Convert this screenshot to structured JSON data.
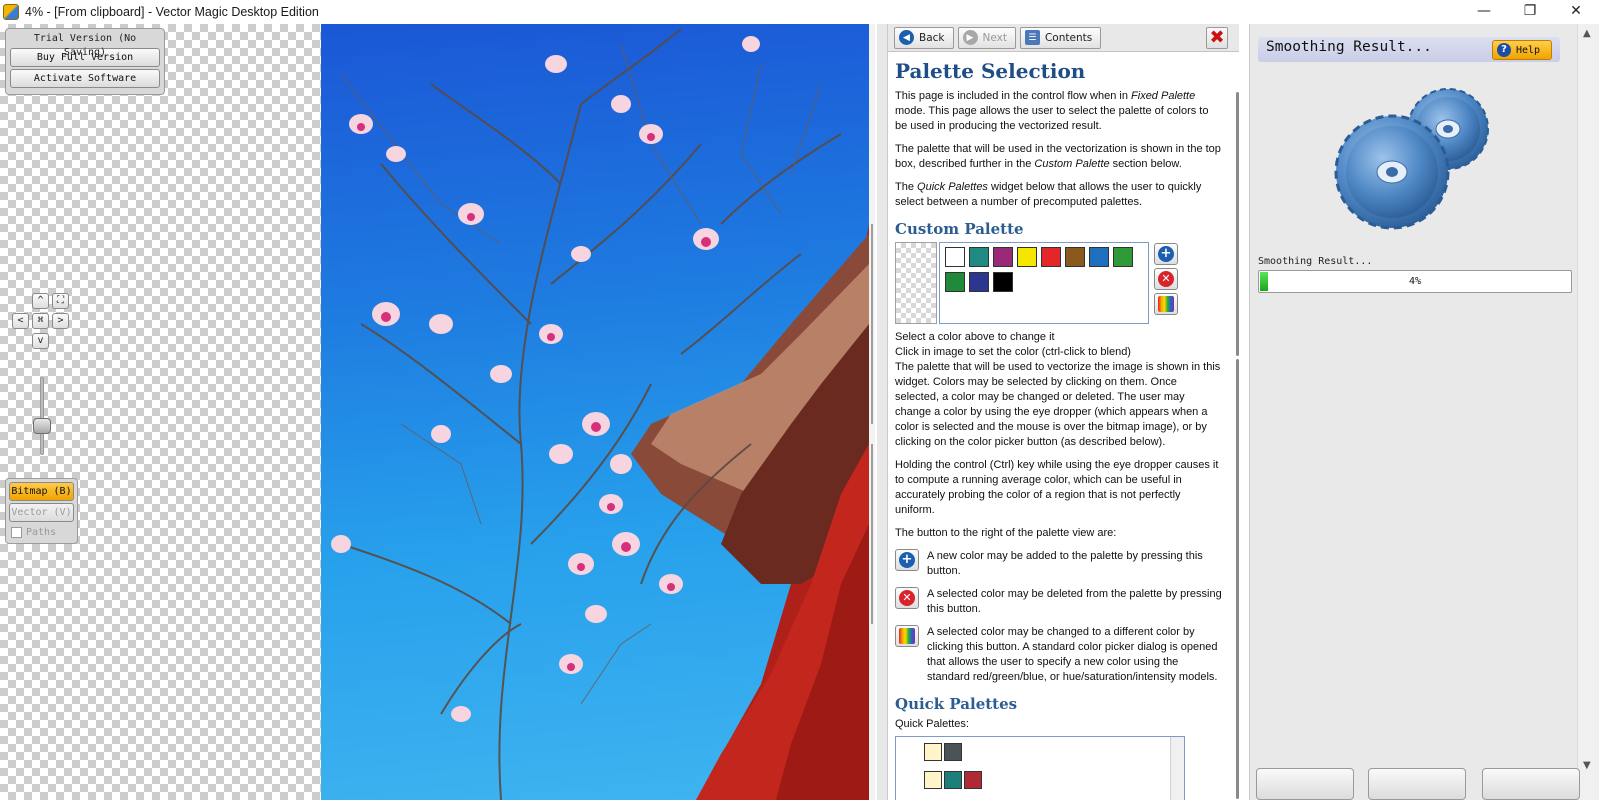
{
  "window": {
    "title": "4% - [From clipboard] - Vector Magic Desktop Edition",
    "controls": {
      "minimize": "—",
      "restore": "❐",
      "close": "✕"
    }
  },
  "trial": {
    "title": "Trial Version (No Saving)",
    "buy_label": "Buy Full Version",
    "activate_label": "Activate Software"
  },
  "nav": {
    "up": "^",
    "fit": "⛶",
    "left": "<",
    "center": "⌘",
    "right": ">",
    "down": "v"
  },
  "view": {
    "bitmap_label": "Bitmap (B)",
    "vector_label": "Vector (V)",
    "paths_label": "Paths"
  },
  "help_toolbar": {
    "back_label": "Back",
    "next_label": "Next",
    "contents_label": "Contents",
    "close_glyph": "✖"
  },
  "help": {
    "title": "Palette Selection",
    "intro_1a": "This page is included in the control flow when in ",
    "intro_1b": "Fixed Palette",
    "intro_1c": " mode. This page allows the user to select the palette of colors to be used in producing the vectorized result.",
    "intro_2a": "The palette that will be used in the vectorization is shown in the top box, described further in the ",
    "intro_2b": "Custom Palette",
    "intro_2c": " section below.",
    "intro_3a": "The ",
    "intro_3b": "Quick Palettes",
    "intro_3c": " widget below that allows the user to quickly select between a number of precomputed palettes.",
    "custom_heading": "Custom Palette",
    "swatches": [
      "#ffffff",
      "#1e8a82",
      "#9a2a78",
      "#f5e600",
      "#e2262a",
      "#8a5a1c",
      "#1f6fbf",
      "#2e9a3a",
      "#1f8a3a",
      "#2c3690",
      "#000000"
    ],
    "hint_1": "Select a color above to change it",
    "hint_2": "Click in image to set the color (ctrl-click to blend)",
    "custom_desc": "The palette that will be used to vectorize the image is shown in this widget. Colors may be selected by clicking on them. Once selected, a color may be changed or deleted. The user may change a color by using the eye dropper (which appears when a color is selected and the mouse is over the bitmap image), or by clicking on the color picker button (as described below).",
    "ctrl_desc": "Holding the control (Ctrl) key while using the eye dropper causes it to compute a running average color, which can be useful in accurately probing the color of a region that is not perfectly uniform.",
    "buttons_intro": "The button to the right of the palette view are:",
    "add_desc": "A new color may be added to the palette by pressing this button.",
    "delete_desc": "A selected color may be deleted from the palette by pressing this button.",
    "change_desc": "A selected color may be changed to a different color by clicking this button. A standard color picker dialog is opened that allows the user to specify a new color using the standard red/green/blue, or hue/saturation/intensity models.",
    "quick_heading": "Quick Palettes",
    "quick_label": "Quick Palettes:",
    "quick_rows": [
      [
        "#fff5c8",
        "#4a5458"
      ],
      [
        "#fff5c8",
        "#1e7f7a",
        "#b02a36"
      ]
    ]
  },
  "status": {
    "header": "Smoothing Result...",
    "help_label": "Help",
    "progress_label": "Smoothing Result...",
    "progress_text": "4%",
    "progress_value": 0.02
  }
}
